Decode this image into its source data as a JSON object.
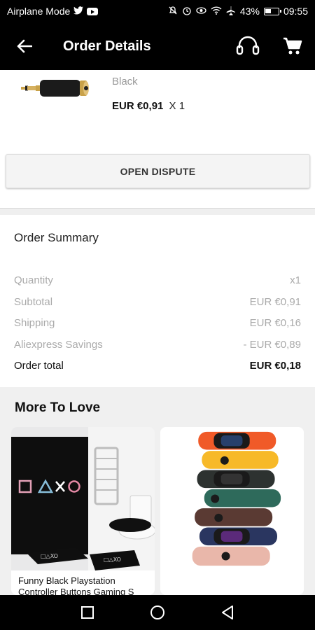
{
  "status_bar": {
    "left_text": "Airplane Mode",
    "battery": "43%",
    "time": "09:55"
  },
  "app_bar": {
    "title": "Order Details",
    "icons": [
      "back-arrow-icon",
      "headset-support-icon",
      "cart-icon"
    ]
  },
  "product": {
    "variant": "Black",
    "price": "EUR €0,91",
    "quantity": "X 1"
  },
  "dispute_button": "OPEN DISPUTE",
  "order_summary": {
    "title": "Order Summary",
    "rows": [
      {
        "label": "Quantity",
        "value": "x1"
      },
      {
        "label": "Subtotal",
        "value": "EUR €0,91"
      },
      {
        "label": "Shipping",
        "value": "EUR €0,16"
      },
      {
        "label": "Aliexpress Savings",
        "value": "- EUR €0,89"
      }
    ],
    "total": {
      "label": "Order total",
      "value": "EUR €0,18"
    }
  },
  "more_to_love": {
    "title": "More To Love",
    "items": [
      {
        "name": "Funny Black Playstation Controller Buttons Gaming S"
      },
      {
        "name": ""
      }
    ]
  },
  "colors": {
    "bar_bg": "#000000",
    "page_bg": "#f2f2f2",
    "muted_text": "#aaaaaa"
  }
}
